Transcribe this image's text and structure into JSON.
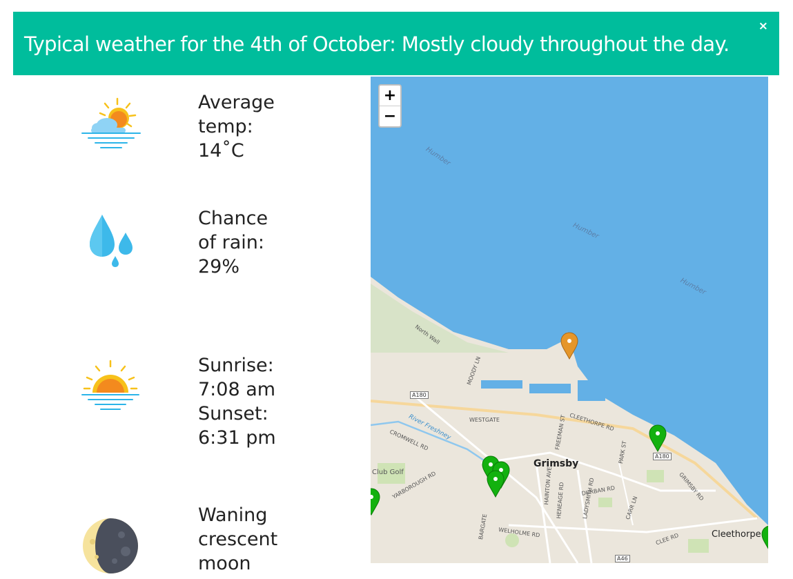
{
  "banner": {
    "title": "Typical weather for the 4th of October: Mostly cloudy throughout the day.",
    "close": "×",
    "color": "#00bd9c"
  },
  "stats": {
    "temp": {
      "icon": "partly-cloudy-icon",
      "line1": "Average",
      "line2": "temp:",
      "line3": "14˚C"
    },
    "rain": {
      "icon": "raindrops-icon",
      "line1": "Chance",
      "line2": "of rain:",
      "line3": "29%"
    },
    "sun": {
      "icon": "sunrise-icon",
      "line1": "Sunrise:",
      "line2": "7:08 am",
      "line3": "Sunset:",
      "line4": "6:31 pm"
    },
    "moon": {
      "icon": "moon-icon",
      "line1": "Waning",
      "line2": "crescent",
      "line3": "moon"
    }
  },
  "map": {
    "zoom_in": "+",
    "zoom_out": "−",
    "water_color": "#63b0e6",
    "labels": {
      "humber1": "Humber",
      "humber2": "Humber",
      "humber3": "Humber",
      "north_wall": "North Wall",
      "grimsby": "Grimsby",
      "cleethorpes": "Cleethorpe",
      "club_golf": "Club Golf",
      "river": "River Freshney",
      "a180_1": "A180",
      "a180_2": "A180",
      "a46": "A46",
      "westgate": "WESTGATE",
      "cleethorpe_rd": "CLEETHORPE RD",
      "cromwell_rd": "CROMWELL RD",
      "yarborough_rd": "YARBOROUGH RD",
      "freeman_st": "FREEMAN ST",
      "park_st": "PARK ST",
      "durban_rd": "DURBAN RD",
      "hainton_ave": "HAINTON AVE",
      "heneage_rd": "HENEAGE RD",
      "ladysmith_rd": "LADYSMITH RD",
      "carr_ln": "CARR LN",
      "grimsby_rd": "GRIMSBY RD",
      "clee_rd": "CLEE RD",
      "welholme_rd": "WELHOLME RD",
      "bargate": "BARGATE",
      "moody": "MOODY LN"
    },
    "marker_colors": {
      "orange": "#e5962a",
      "green": "#13b10f"
    }
  }
}
